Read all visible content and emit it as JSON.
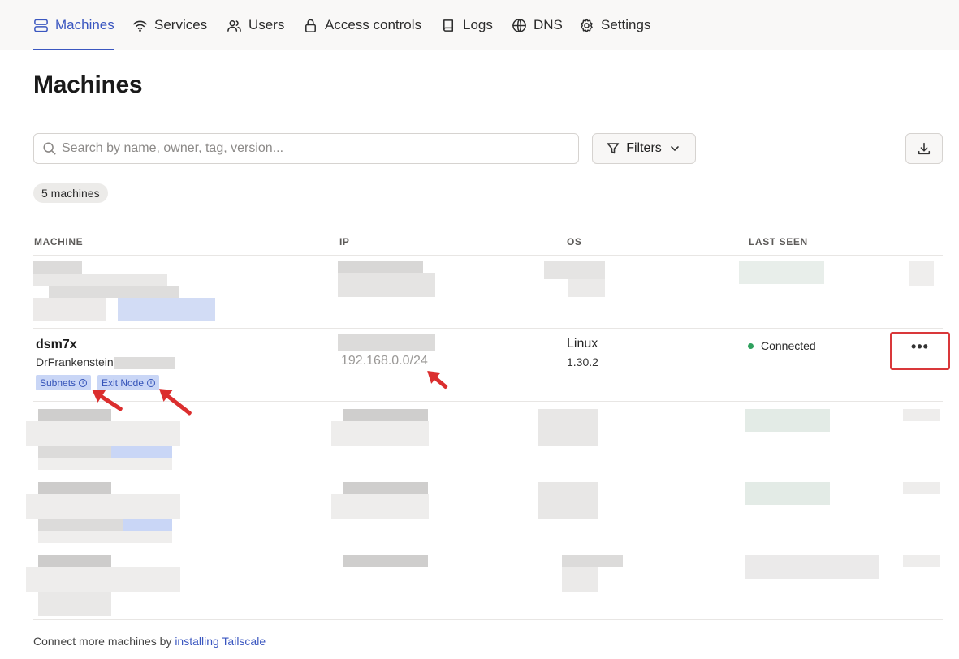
{
  "nav": {
    "items": [
      {
        "label": "Machines",
        "icon": "server-icon",
        "active": true
      },
      {
        "label": "Services",
        "icon": "wifi-icon"
      },
      {
        "label": "Users",
        "icon": "users-icon"
      },
      {
        "label": "Access controls",
        "icon": "lock-icon"
      },
      {
        "label": "Logs",
        "icon": "book-icon"
      },
      {
        "label": "DNS",
        "icon": "globe-icon"
      },
      {
        "label": "Settings",
        "icon": "gear-icon"
      }
    ]
  },
  "page": {
    "title": "Machines"
  },
  "toolbar": {
    "search_placeholder": "Search by name, owner, tag, version...",
    "filters_label": "Filters",
    "download_icon": "download-icon"
  },
  "count_badge": "5 machines",
  "table": {
    "headers": {
      "machine": "MACHINE",
      "ip": "IP",
      "os": "OS",
      "last_seen": "LAST SEEN"
    },
    "highlighted_row": {
      "name": "dsm7x",
      "owner": "DrFrankenstein",
      "tags": [
        "Subnets",
        "Exit Node"
      ],
      "subnet": "192.168.0.0/24",
      "os": "Linux",
      "os_version": "1.30.2",
      "status": "Connected",
      "status_color": "#2fa15e",
      "menu_label": "•••"
    }
  },
  "annotations": {
    "highlight_color": "#d9383a",
    "arrow_color": "#db2e2e"
  },
  "footer": {
    "text": "Connect more machines by ",
    "link": "installing Tailscale"
  },
  "colors": {
    "accent": "#3b57c0",
    "tag_bg": "#c9d6f6"
  }
}
